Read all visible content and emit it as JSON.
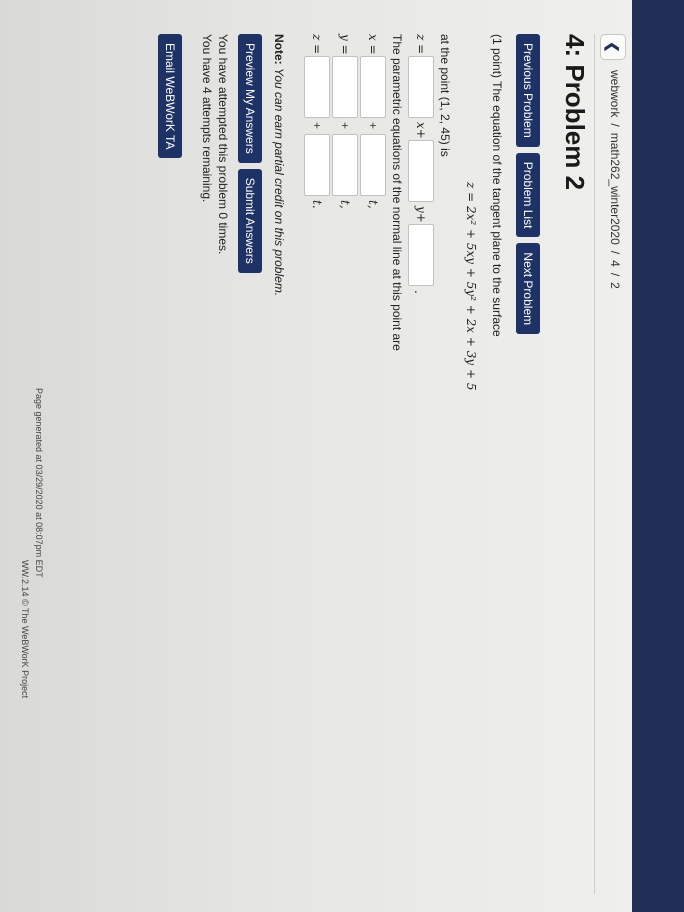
{
  "breadcrumb": {
    "part1": "webwork",
    "sep1": "/",
    "part2": "math262_winter2020",
    "sep2": "/",
    "part3": "4",
    "sep3": "/",
    "part4": "2"
  },
  "page_title": "4: Problem 2",
  "nav": {
    "previous": "Previous Problem",
    "list": "Problem List",
    "next": "Next Problem"
  },
  "problem": {
    "intro": "(1 point) The equation of the tangent plane to the surface",
    "surface_eq": "z = 2x² + 5xy + 5y² + 2x + 3y + 5",
    "point_text": "at the point (1, 2, 45) is",
    "tangent": {
      "lhs": "z =",
      "x_term": "x+",
      "y_term": "y+",
      "period": "."
    },
    "normal_intro": "The parametric equations of the normal line at this point are",
    "normal": [
      {
        "lhs": "x =",
        "plus": "+",
        "t": "t,"
      },
      {
        "lhs": "y =",
        "plus": "+",
        "t": "t,"
      },
      {
        "lhs": "z =",
        "plus": "+",
        "t": "t."
      }
    ]
  },
  "note": {
    "label": "Note:",
    "text": "You can earn partial credit on this problem."
  },
  "actions": {
    "preview": "Preview My Answers",
    "submit": "Submit Answers"
  },
  "status": {
    "attempted": "You have attempted this problem 0 times.",
    "remaining": "You have 4 attempts remaining."
  },
  "email_button": "Email WeBWorK TA",
  "footer": {
    "generated": "Page generated at 03/29/2020 at 08:07pm EDT",
    "project": "WW.2.14 © The WeBWorK Project"
  },
  "colors": {
    "navbar": "#1f2f56",
    "button": "#1f3266"
  }
}
